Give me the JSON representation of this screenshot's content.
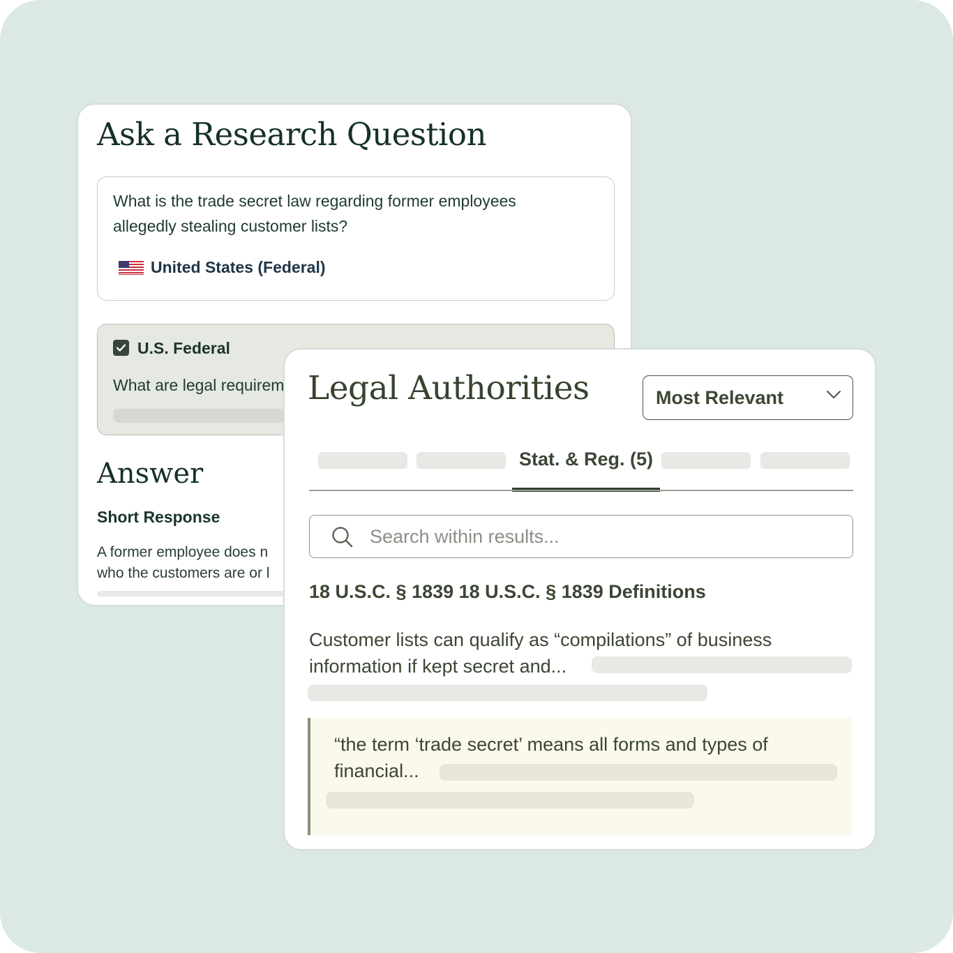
{
  "research": {
    "title": "Ask a Research Question",
    "question_line1": "What is the trade secret law regarding former employees",
    "question_line2": "allegedly stealing customer lists?",
    "jurisdiction": "United States (Federal)",
    "jurisdiction_icon": "us-flag-icon",
    "subquestion": {
      "checked": true,
      "label": "U.S. Federal",
      "text": "What are legal requirem"
    },
    "answer_heading": "Answer",
    "short_response_label": "Short Response",
    "answer_line1": "A former employee does n",
    "answer_line2": "who the customers are or l"
  },
  "authorities": {
    "title": "Legal Authorities",
    "sort": {
      "selected": "Most Relevant",
      "icon": "chevron-down-icon"
    },
    "tabs": {
      "active_label": "Stat. & Reg. (5)"
    },
    "search": {
      "placeholder": "Search within results...",
      "icon": "search-icon"
    },
    "result": {
      "citation": "18 U.S.C. § 1839 18 U.S.C. § 1839 Definitions",
      "summary_line1": "Customer lists can qualify as “compilations” of business",
      "summary_line2": "information if kept secret and...",
      "quote_line1": "“the term ‘trade secret’ means all forms and types of",
      "quote_line2": "financial..."
    }
  },
  "colors": {
    "background": "#dbe8e3",
    "heading_green": "#16302a",
    "olive_text": "#3c4634",
    "quote_background": "#fbf9ed",
    "skeleton": "#e7e9e5"
  }
}
